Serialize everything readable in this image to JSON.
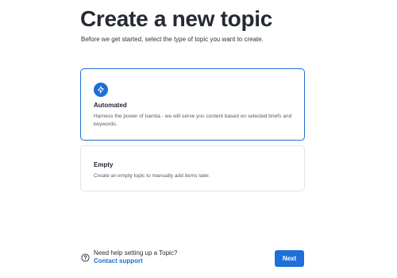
{
  "header": {
    "title": "Create a new topic",
    "subtitle": "Before we get started, select the type of topic you want to create."
  },
  "options": [
    {
      "title": "Automated",
      "description": "Harness the power of Isentia - we will serve you content based on selected briefs and keywords.",
      "icon": "lightning-bolt-icon",
      "selected": true
    },
    {
      "title": "Empty",
      "description": "Create an empty topic to manually add items later.",
      "selected": false
    }
  ],
  "help": {
    "label": "Need help setting up a Topic?",
    "link": "Contact support",
    "icon": "question-circle-icon"
  },
  "actions": {
    "next_label": "Next"
  },
  "colors": {
    "accent": "#1d6fd6",
    "border": "#e3e5e9",
    "background": "#ffffff"
  }
}
